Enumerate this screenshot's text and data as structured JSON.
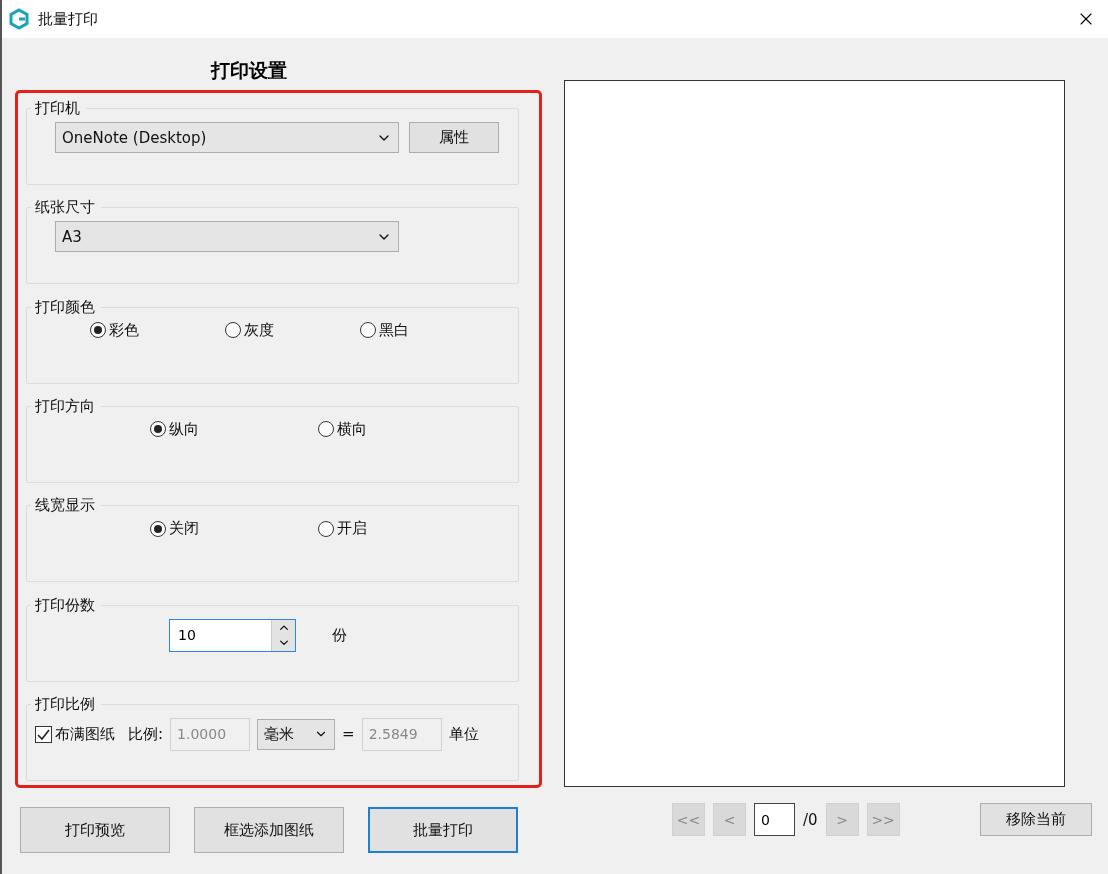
{
  "window": {
    "title": "批量打印"
  },
  "settings": {
    "title": "打印设置",
    "groups": [
      {
        "kind": "printer",
        "label": "打印机",
        "value": "OneNote (Desktop)",
        "button": "属性"
      },
      {
        "kind": "select",
        "label": "纸张尺寸",
        "value": "A3"
      },
      {
        "kind": "radio",
        "label": "打印颜色",
        "options": [
          {
            "label": "彩色",
            "selected": true
          },
          {
            "label": "灰度",
            "selected": false
          },
          {
            "label": "黑白",
            "selected": false
          }
        ]
      },
      {
        "kind": "radio",
        "label": "打印方向",
        "options": [
          {
            "label": "纵向",
            "selected": true
          },
          {
            "label": "横向",
            "selected": false
          }
        ]
      },
      {
        "kind": "radio",
        "label": "线宽显示",
        "options": [
          {
            "label": "关闭",
            "selected": true
          },
          {
            "label": "开启",
            "selected": false
          }
        ]
      },
      {
        "kind": "spin",
        "label": "打印份数",
        "value": "10",
        "unit": "份"
      },
      {
        "kind": "scale",
        "label": "打印比例",
        "fit": {
          "label": "布满图纸",
          "checked": true
        },
        "ratio_label": "比例:",
        "ratio": "1.0000",
        "unit_select": "毫米",
        "equals": "=",
        "units_value": "2.5849",
        "units_label": "单位"
      }
    ]
  },
  "actions": [
    {
      "label": "打印预览",
      "focused": false
    },
    {
      "label": "框选添加图纸",
      "focused": false
    },
    {
      "label": "批量打印",
      "focused": true
    }
  ],
  "pager": {
    "first": "<<",
    "prev": "<",
    "page": "0",
    "total": "/0",
    "next": ">",
    "last": ">>"
  },
  "remove_button": "移除当前"
}
